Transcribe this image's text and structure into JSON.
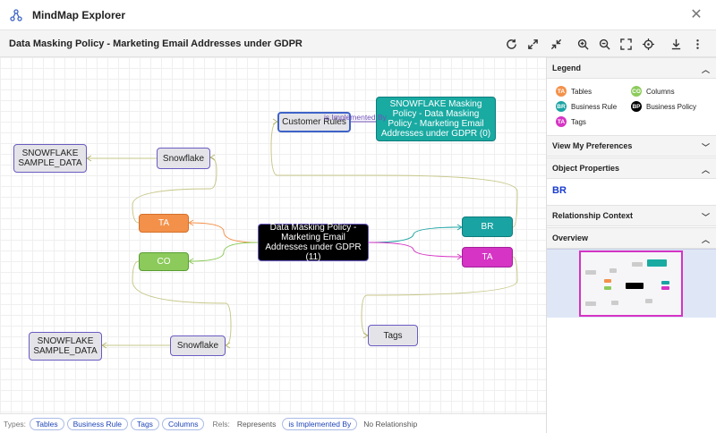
{
  "app": {
    "title": "MindMap Explorer"
  },
  "toolbar": {
    "title": "Data Masking Policy - Marketing Email Addresses under GDPR"
  },
  "graph": {
    "center": "Data Masking Policy - Marketing Email Addresses under GDPR  (11)",
    "snowflake_top": "Snowflake",
    "sample_top": "SNOWFLAKE SAMPLE_DATA",
    "snowflake_bottom": "Snowflake",
    "sample_bottom": "SNOWFLAKE SAMPLE_DATA",
    "ta_left": "TA",
    "co_left": "CO",
    "br_right": "BR",
    "ta_right": "TA",
    "tags": "Tags",
    "customer_rules": "Customer Rules",
    "masking_policy": "SNOWFLAKE Masking Policy - Data Masking Policy - Marketing Email Addresses under GDPR  (0)",
    "edge_label": "is Implemented By"
  },
  "sidebar": {
    "legend_title": "Legend",
    "legend": [
      {
        "badge": "TA",
        "label": "Tables",
        "color": "#f3914a"
      },
      {
        "badge": "CO",
        "label": "Columns",
        "color": "#8ccb5b"
      },
      {
        "badge": "BR",
        "label": "Business Rule",
        "color": "#1aa3a3"
      },
      {
        "badge": "BP",
        "label": "Business Policy",
        "color": "#000000"
      },
      {
        "badge": "TA",
        "label": "Tags",
        "color": "#d534c4"
      }
    ],
    "prefs_title": "View My Preferences",
    "props_title": "Object Properties",
    "props_value": "BR",
    "rel_title": "Relationship Context",
    "overview_title": "Overview"
  },
  "bottom": {
    "types_label": "Types:",
    "types": [
      "Tables",
      "Business Rule",
      "Tags",
      "Columns"
    ],
    "rels_label": "Rels:",
    "rels": [
      "Represents",
      "is Implemented By",
      "No Relationship"
    ]
  },
  "colors": {
    "accent": "#3e63c8",
    "ta": "#f3914a",
    "co": "#8ccb5b",
    "br": "#1aa3a3",
    "tags": "#d534c4"
  }
}
